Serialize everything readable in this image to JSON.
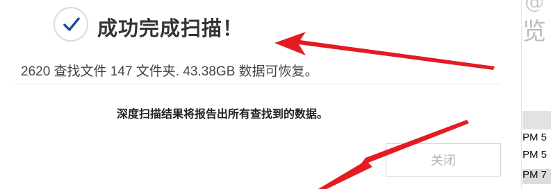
{
  "dialog": {
    "title": "成功完成扫描！",
    "summary": "2620 查找文件 147 文件夹. 43.38GB 数据可恢复。",
    "deep_scan_note": "深度扫描结果将报告出所有查找到的数据。",
    "close_label": "关闭"
  },
  "background_window": {
    "ghost_top": "@",
    "ghost_char": "览",
    "rows": [
      {
        "text": "PM 5"
      },
      {
        "text": "PM 5"
      },
      {
        "text": "PM 7"
      }
    ]
  },
  "icons": {
    "success": "check-icon"
  },
  "colors": {
    "check": "#1e4b9a",
    "arrow": "#e31b23",
    "button_text": "#b5b5b5",
    "header_band": "#e2e2e2",
    "selected_row": "#dcdcdc"
  }
}
